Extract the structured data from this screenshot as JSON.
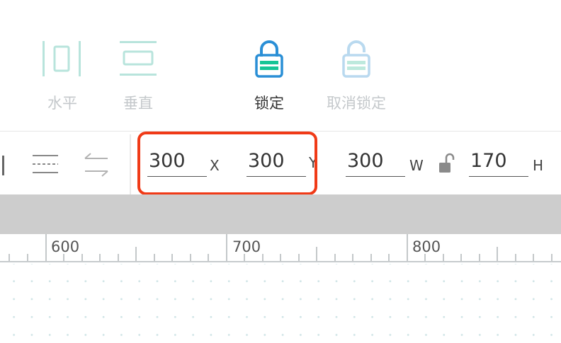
{
  "toolbar": {
    "horizontal_label": "水平",
    "vertical_label": "垂直",
    "lock_label": "锁定",
    "unlock_label": "取消锁定"
  },
  "position": {
    "x_value": "300",
    "x_unit": "X",
    "y_value": "300",
    "y_unit": "Y"
  },
  "size": {
    "w_value": "300",
    "w_unit": "W",
    "h_value": "170",
    "h_unit": "H"
  },
  "ruler": {
    "labels": [
      "600",
      "700",
      "800"
    ]
  },
  "colors": {
    "accent_teal": "#b8e4dc",
    "lock_blue": "#2a8fd6",
    "lock_green": "#17c596",
    "highlight": "#f03a17"
  }
}
